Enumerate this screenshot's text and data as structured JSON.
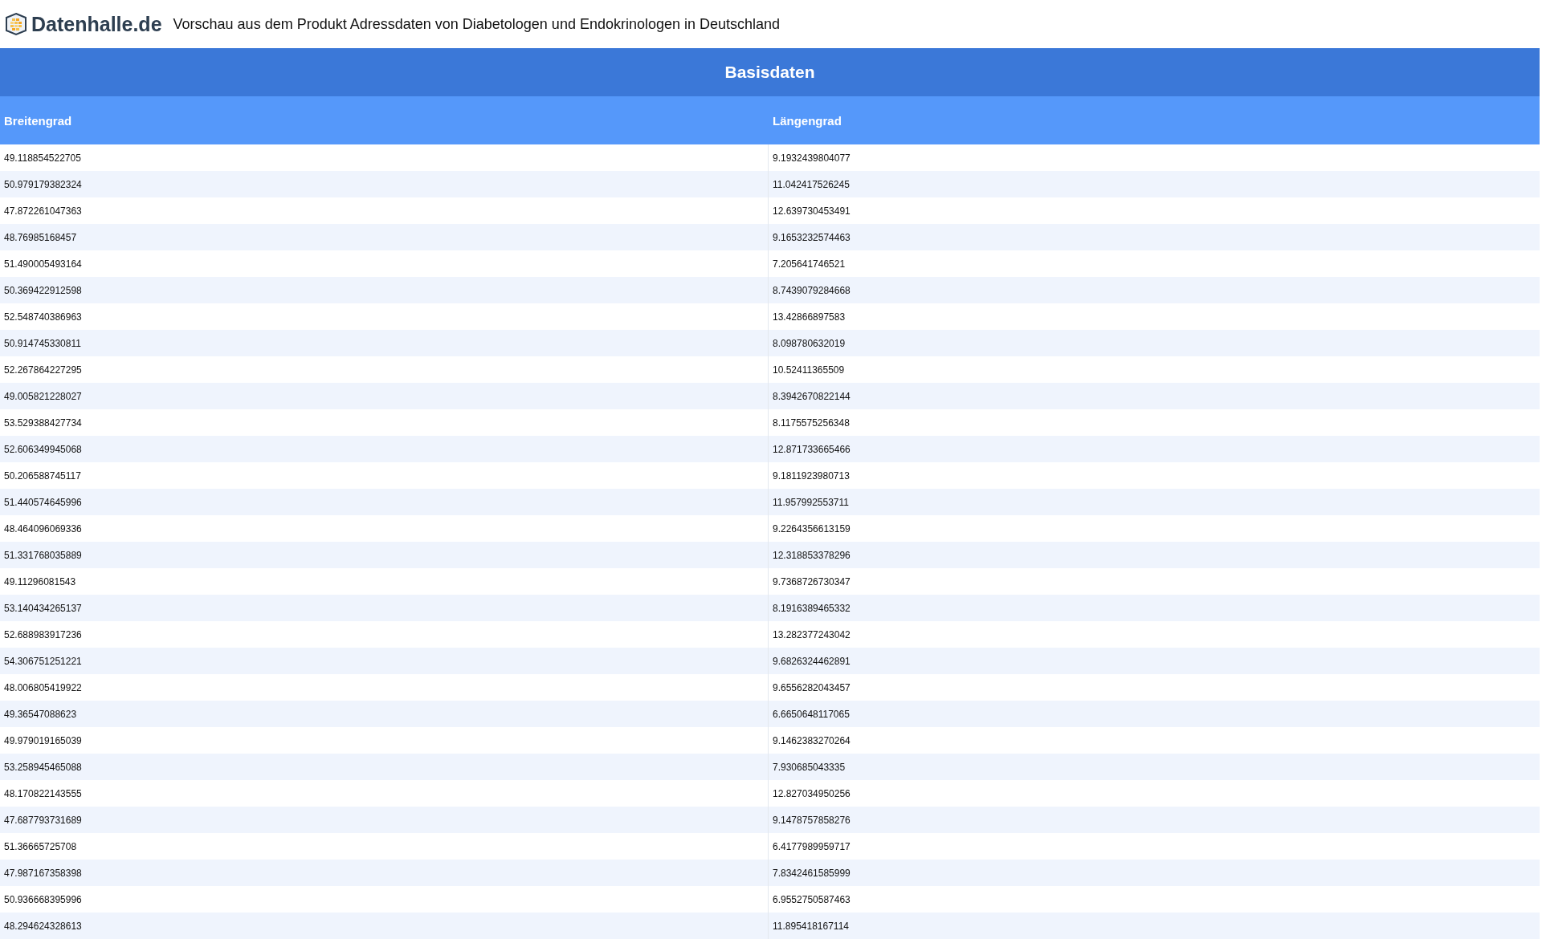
{
  "header": {
    "logo_text": "Datenhalle.de",
    "title": "Vorschau aus dem Produkt Adressdaten von Diabetologen und Endokrinologen in Deutschland"
  },
  "table": {
    "title": "Basisdaten",
    "columns": [
      "Breitengrad",
      "Längengrad"
    ],
    "rows": [
      [
        "49.118854522705",
        "9.1932439804077"
      ],
      [
        "50.979179382324",
        "11.042417526245"
      ],
      [
        "47.872261047363",
        "12.639730453491"
      ],
      [
        "48.76985168457",
        "9.1653232574463"
      ],
      [
        "51.490005493164",
        "7.205641746521"
      ],
      [
        "50.369422912598",
        "8.7439079284668"
      ],
      [
        "52.548740386963",
        "13.42866897583"
      ],
      [
        "50.914745330811",
        "8.098780632019"
      ],
      [
        "52.267864227295",
        "10.52411365509"
      ],
      [
        "49.005821228027",
        "8.3942670822144"
      ],
      [
        "53.529388427734",
        "8.1175575256348"
      ],
      [
        "52.606349945068",
        "12.871733665466"
      ],
      [
        "50.206588745117",
        "9.1811923980713"
      ],
      [
        "51.440574645996",
        "11.957992553711"
      ],
      [
        "48.464096069336",
        "9.2264356613159"
      ],
      [
        "51.331768035889",
        "12.318853378296"
      ],
      [
        "49.11296081543",
        "9.7368726730347"
      ],
      [
        "53.140434265137",
        "8.1916389465332"
      ],
      [
        "52.688983917236",
        "13.282377243042"
      ],
      [
        "54.306751251221",
        "9.6826324462891"
      ],
      [
        "48.006805419922",
        "9.6556282043457"
      ],
      [
        "49.36547088623",
        "6.6650648117065"
      ],
      [
        "49.979019165039",
        "9.1462383270264"
      ],
      [
        "53.258945465088",
        "7.930685043335"
      ],
      [
        "48.170822143555",
        "12.827034950256"
      ],
      [
        "47.687793731689",
        "9.1478757858276"
      ],
      [
        "51.36665725708",
        "6.4177989959717"
      ],
      [
        "47.987167358398",
        "7.8342461585999"
      ],
      [
        "50.936668395996",
        "6.9552750587463"
      ],
      [
        "48.294624328613",
        "11.895418167114"
      ]
    ]
  }
}
